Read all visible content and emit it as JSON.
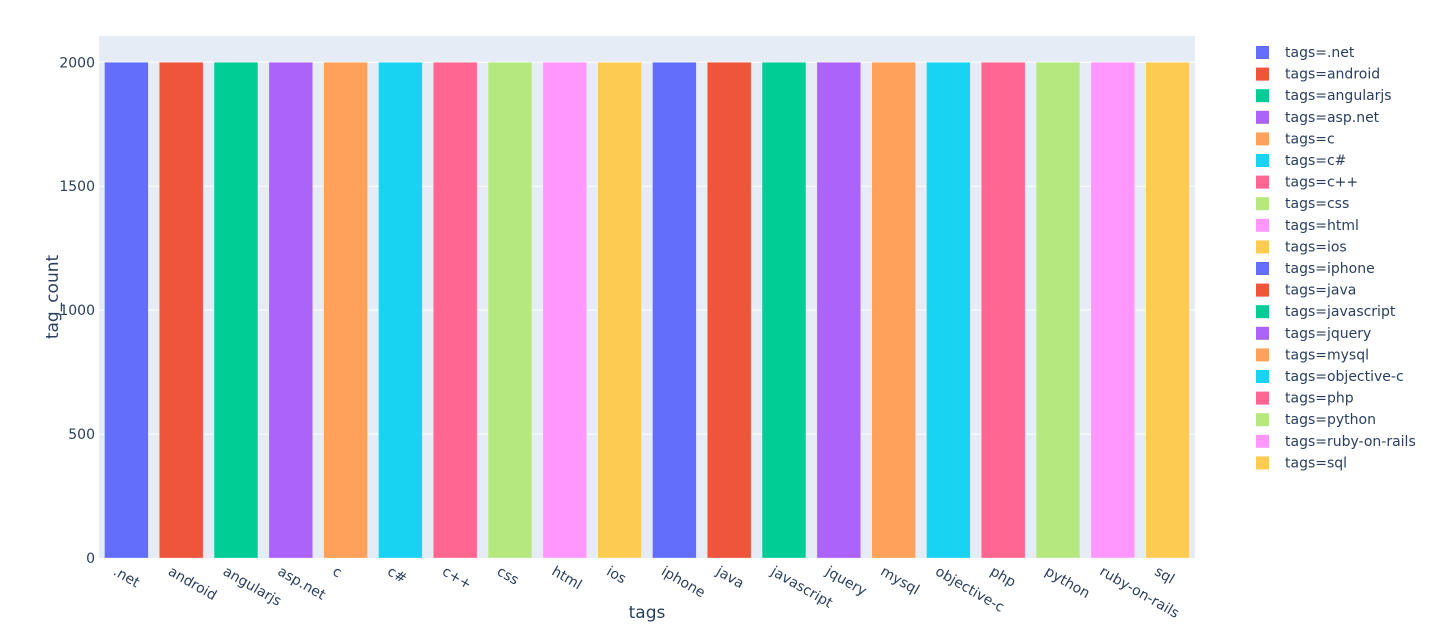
{
  "chart_data": {
    "type": "bar",
    "title": "",
    "xlabel": "tags",
    "ylabel": "tag_count",
    "categories": [
      ".net",
      "android",
      "angularjs",
      "asp.net",
      "c",
      "c#",
      "c++",
      "css",
      "html",
      "ios",
      "iphone",
      "java",
      "javascript",
      "jquery",
      "mysql",
      "objective-c",
      "php",
      "python",
      "ruby-on-rails",
      "sql"
    ],
    "values": [
      2000,
      2000,
      2000,
      2000,
      2000,
      2000,
      2000,
      2000,
      2000,
      2000,
      2000,
      2000,
      2000,
      2000,
      2000,
      2000,
      2000,
      2000,
      2000,
      2000
    ],
    "colors": [
      "#636efa",
      "#EF553B",
      "#00cc96",
      "#ab63fa",
      "#FFA15A",
      "#19d3f3",
      "#FF6692",
      "#B6E880",
      "#FF97FF",
      "#FECB52",
      "#636efa",
      "#EF553B",
      "#00cc96",
      "#ab63fa",
      "#FFA15A",
      "#19d3f3",
      "#FF6692",
      "#B6E880",
      "#FF97FF",
      "#FECB52"
    ],
    "ylim": [
      0,
      2106
    ],
    "yticks": [
      0,
      500,
      1000,
      1500,
      2000
    ],
    "ytick_labels": [
      "0",
      "500",
      "1000",
      "1500",
      "2000"
    ],
    "grid": true,
    "plot_bgcolor": "#e5ecf6",
    "legend_position": "right",
    "legend_entries": [
      "tags=.net",
      "tags=android",
      "tags=angularjs",
      "tags=asp.net",
      "tags=c",
      "tags=c#",
      "tags=c++",
      "tags=css",
      "tags=html",
      "tags=ios",
      "tags=iphone",
      "tags=java",
      "tags=javascript",
      "tags=jquery",
      "tags=mysql",
      "tags=objective-c",
      "tags=php",
      "tags=python",
      "tags=ruby-on-rails",
      "tags=sql"
    ]
  }
}
